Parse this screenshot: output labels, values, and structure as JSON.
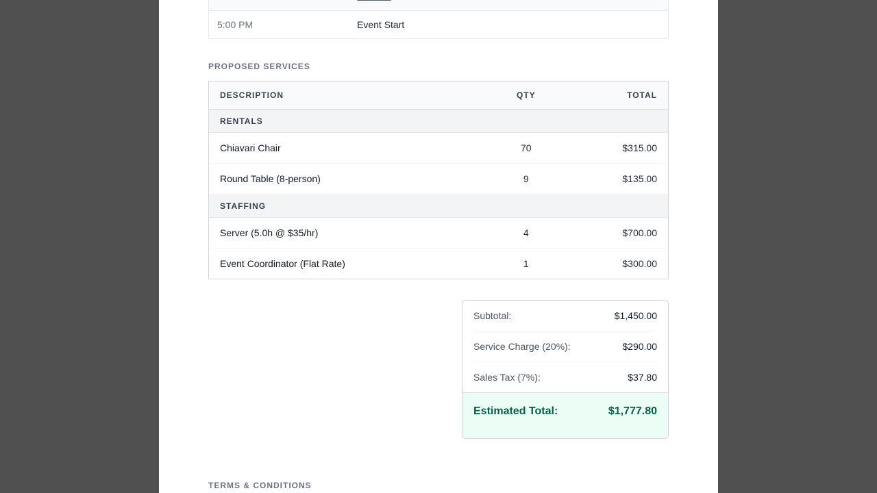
{
  "schedule": {
    "rows": [
      {
        "time": "5:00 PM",
        "event": "Event Start"
      }
    ]
  },
  "services": {
    "section_title": "PROPOSED SERVICES",
    "columns": {
      "description": "DESCRIPTION",
      "qty": "QTY",
      "total": "TOTAL"
    },
    "groups": [
      {
        "name": "RENTALS",
        "items": [
          {
            "description": "Chiavari Chair",
            "qty": "70",
            "total": "$315.00"
          },
          {
            "description": "Round Table (8-person)",
            "qty": "9",
            "total": "$135.00"
          }
        ]
      },
      {
        "name": "STAFFING",
        "items": [
          {
            "description": "Server (5.0h @ $35/hr)",
            "qty": "4",
            "total": "$700.00"
          },
          {
            "description": "Event Coordinator (Flat Rate)",
            "qty": "1",
            "total": "$300.00"
          }
        ]
      }
    ]
  },
  "totals": {
    "subtotal_label": "Subtotal:",
    "subtotal_value": "$1,450.00",
    "service_label": "Service Charge (20%):",
    "service_value": "$290.00",
    "tax_label": "Sales Tax (7%):",
    "tax_value": "$37.80",
    "grand_label": "Estimated Total:",
    "grand_value": "$1,777.80"
  },
  "terms": {
    "section_title": "TERMS & CONDITIONS"
  },
  "colors": {
    "backdrop": "#505050",
    "page": "#ffffff",
    "accent_green": "#065f46",
    "accent_green_bg": "#ecfdf5"
  }
}
